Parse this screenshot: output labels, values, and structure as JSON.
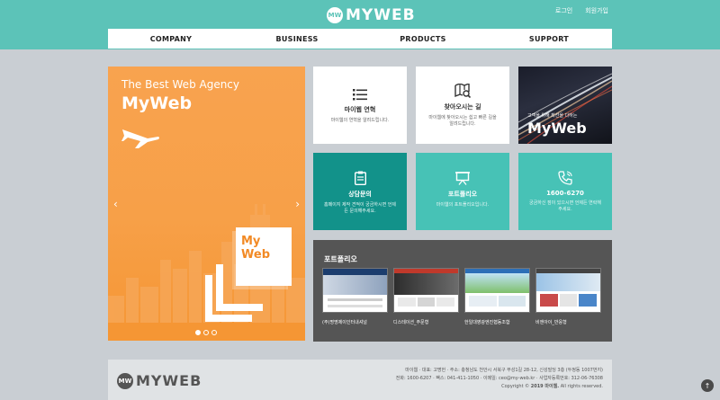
{
  "header": {
    "logo_mark": "MW",
    "logo_text": "MYWEB",
    "util_links": [
      "로그인",
      "회원가입"
    ]
  },
  "nav": {
    "items": [
      "COMPANY",
      "BUSINESS",
      "PRODUCTS",
      "SUPPORT"
    ]
  },
  "hero": {
    "subtitle": "The Best Web Agency",
    "title": "MyWeb",
    "brand_line1": "My",
    "brand_line2": "Web",
    "prev_arrow": "‹",
    "next_arrow": "›",
    "slide_count": 3,
    "active_slide": 1,
    "accent_color": "#f8a34f"
  },
  "tiles": [
    {
      "title": "마이웹 연혁",
      "desc": "마이웹의 연혁을 알려드립니다.",
      "icon": "list-icon"
    },
    {
      "title": "찾아오시는 길",
      "desc": "마이웹에 찾아오시는 쉽고 빠른 길을 알려드립니다.",
      "icon": "map-search-icon"
    },
    {
      "title": "상담문의",
      "desc": "홈페이지 제작 견적이 궁금하시면 언제든 문의해주세요.",
      "icon": "clipboard-icon"
    },
    {
      "title": "포트폴리오",
      "desc": "마이웹의 포트폴리오입니다.",
      "icon": "presentation-board-icon"
    },
    {
      "title": "1600-6270",
      "desc": "궁금하신 점이 있으시면 언제든 연락해주세요.",
      "icon": "phone-icon"
    }
  ],
  "photo_tile": {
    "subtitle": "고객을 위해 최선을 다하는",
    "title": "MyWeb"
  },
  "portfolio": {
    "title": "포트폴리오",
    "items": [
      {
        "caption": "(주)명명제이인터내셔널"
      },
      {
        "caption": "디스테이션_주문형"
      },
      {
        "caption": "한일대영광엔진협동조합"
      },
      {
        "caption": "비엔아이_반응형"
      }
    ]
  },
  "footer": {
    "logo_mark": "MW",
    "logo_text": "MYWEB",
    "line1": "마이웹 · 대표: 고명헌 · 주소: 충청남도 천안시 서북구 부성1길 28-12, 신성빌딩 3층 (두정동 1007번지)",
    "line2": "전화: 1600-6207 · 팩스: 041-411-1050 · 이메일: ceo@my-web.kr · 사업자등록번호: 312-06-76308",
    "line3_prefix": "Copyright ©",
    "line3_brand": "2019 마이웹.",
    "line3_suffix": "All rights reserved.",
    "top_button": "↑"
  }
}
